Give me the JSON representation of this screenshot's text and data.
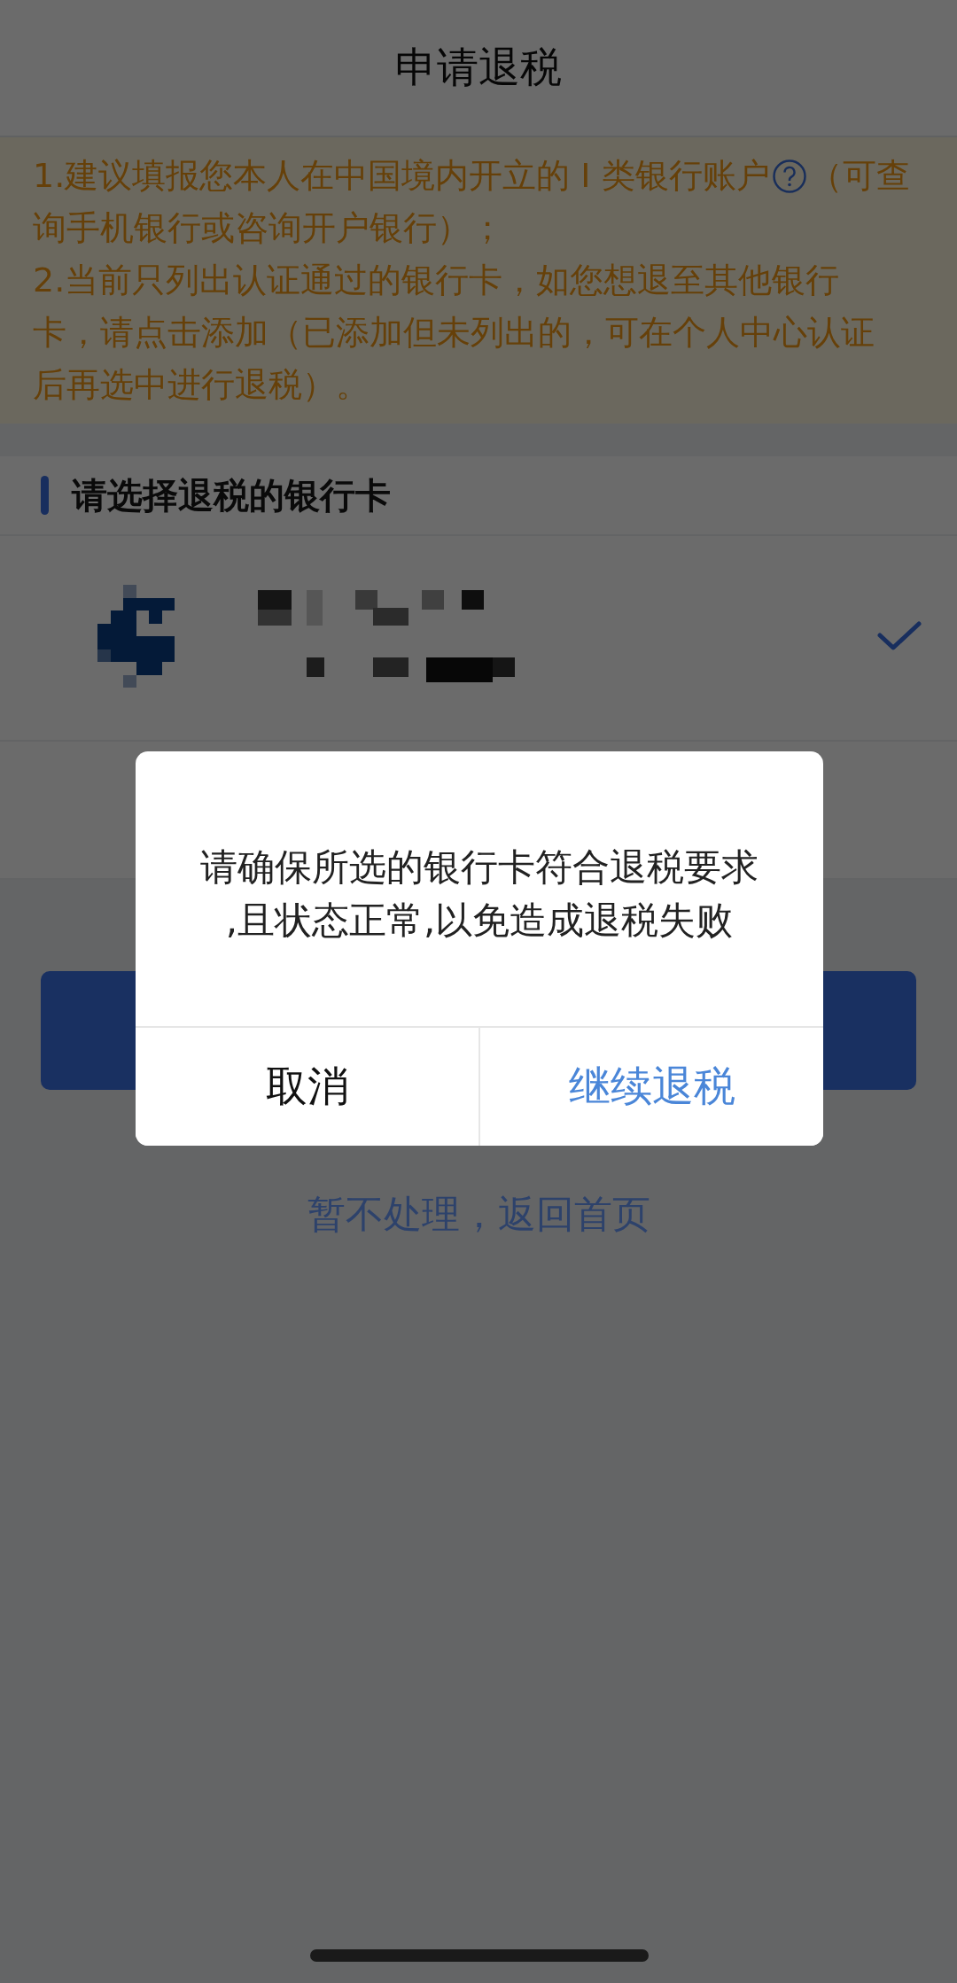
{
  "header": {
    "title": "申请退税"
  },
  "notice": {
    "item1_before_icon": "1.建议填报您本人在中国境内开立的 I 类银行账户",
    "item1_after_icon": "（可查",
    "item1_line2": "询手机银行或咨询开户银行）；",
    "item2": "2.当前只列出认证通过的银行卡，如您想退至其他银行卡，请点击添加（已添加但未列出的，可在个人中心认证后再选中进行退税）。"
  },
  "section_title": "请选择退税的银行卡",
  "cards": [
    {
      "selected": true
    }
  ],
  "return_link": "暂不处理，返回首页",
  "dialog": {
    "message": "请确保所选的银行卡符合退税要求,且状态正常,以免造成退税失败",
    "buttons": [
      {
        "label": "取消",
        "kind": "cancel"
      },
      {
        "label": "继续退税",
        "kind": "confirm"
      }
    ]
  }
}
